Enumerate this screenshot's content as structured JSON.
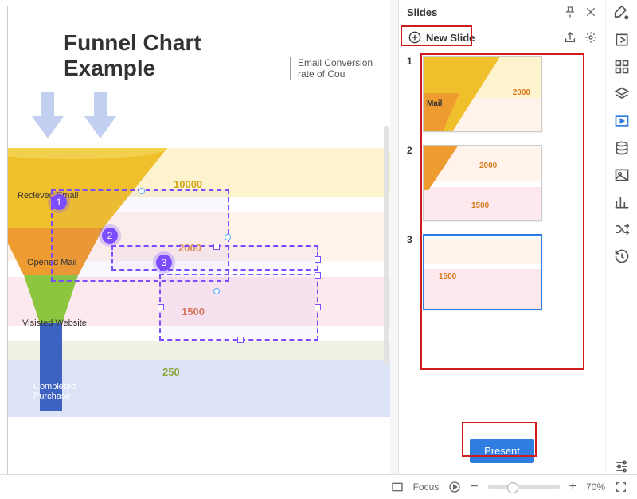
{
  "canvas": {
    "title_line1": "Funnel Chart",
    "title_line2": "Example",
    "subtitle": "Email Conversion rate of Cou",
    "arrows": [
      "#c3cff0",
      "#c3cff0"
    ],
    "stripe_values": {
      "v1": "10000",
      "v2": "2000",
      "v3": "1500",
      "v4": "250"
    },
    "segments": {
      "s1": "Recieved Email",
      "s2": "Opened Mail",
      "s3": "Visisted Website",
      "s4": "Completed Purchase"
    },
    "marker_labels": {
      "m1": "1",
      "m2": "2",
      "m3": "3"
    }
  },
  "chart_data": {
    "type": "funnel",
    "title": "Funnel Chart Example",
    "subtitle": "Email Conversion rate of Cou",
    "categories": [
      "Recieved Email",
      "Opened Mail",
      "Visisted Website",
      "Completed Purchase"
    ],
    "values": [
      10000,
      2000,
      1500,
      250
    ],
    "colors": [
      "#f0c02c",
      "#ee9b2f",
      "#8cc63f",
      "#3e62c1"
    ],
    "background_stripe_colors": [
      "#fdf3cf",
      "#fff3eb",
      "#fde8ee",
      "#eef1e4",
      "#dde3f6"
    ]
  },
  "panel": {
    "title": "Slides",
    "new_slide_label": "New Slide",
    "present_label": "Present",
    "slides": [
      {
        "num": "1",
        "val_a": "2000",
        "label_a": "Mail",
        "active": false
      },
      {
        "num": "2",
        "val_a": "2000",
        "val_b": "1500",
        "active": false
      },
      {
        "num": "3",
        "val_b": "1500",
        "active": true
      }
    ]
  },
  "status": {
    "focus_label": "Focus",
    "zoom_label": "70%"
  },
  "icons": {
    "pin": "pin-icon",
    "close": "close-icon",
    "paint": "paint-icon",
    "share": "share-icon",
    "gear": "gear-icon",
    "plus_circle": "plus-circle-icon"
  }
}
